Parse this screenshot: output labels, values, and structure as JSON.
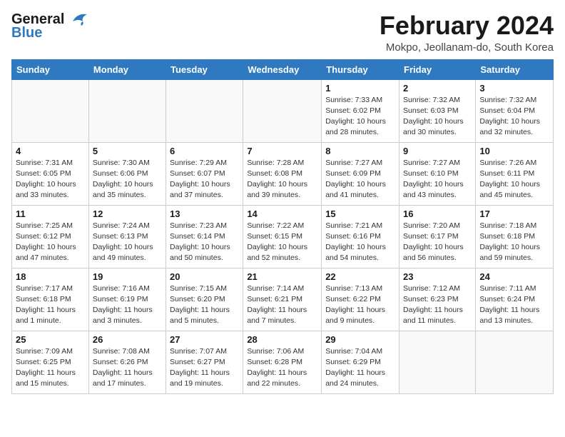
{
  "header": {
    "logo_line1": "General",
    "logo_line2": "Blue",
    "title": "February 2024",
    "subtitle": "Mokpo, Jeollanam-do, South Korea"
  },
  "days_of_week": [
    "Sunday",
    "Monday",
    "Tuesday",
    "Wednesday",
    "Thursday",
    "Friday",
    "Saturday"
  ],
  "weeks": [
    [
      {
        "day": "",
        "info": ""
      },
      {
        "day": "",
        "info": ""
      },
      {
        "day": "",
        "info": ""
      },
      {
        "day": "",
        "info": ""
      },
      {
        "day": "1",
        "info": "Sunrise: 7:33 AM\nSunset: 6:02 PM\nDaylight: 10 hours and 28 minutes."
      },
      {
        "day": "2",
        "info": "Sunrise: 7:32 AM\nSunset: 6:03 PM\nDaylight: 10 hours and 30 minutes."
      },
      {
        "day": "3",
        "info": "Sunrise: 7:32 AM\nSunset: 6:04 PM\nDaylight: 10 hours and 32 minutes."
      }
    ],
    [
      {
        "day": "4",
        "info": "Sunrise: 7:31 AM\nSunset: 6:05 PM\nDaylight: 10 hours and 33 minutes."
      },
      {
        "day": "5",
        "info": "Sunrise: 7:30 AM\nSunset: 6:06 PM\nDaylight: 10 hours and 35 minutes."
      },
      {
        "day": "6",
        "info": "Sunrise: 7:29 AM\nSunset: 6:07 PM\nDaylight: 10 hours and 37 minutes."
      },
      {
        "day": "7",
        "info": "Sunrise: 7:28 AM\nSunset: 6:08 PM\nDaylight: 10 hours and 39 minutes."
      },
      {
        "day": "8",
        "info": "Sunrise: 7:27 AM\nSunset: 6:09 PM\nDaylight: 10 hours and 41 minutes."
      },
      {
        "day": "9",
        "info": "Sunrise: 7:27 AM\nSunset: 6:10 PM\nDaylight: 10 hours and 43 minutes."
      },
      {
        "day": "10",
        "info": "Sunrise: 7:26 AM\nSunset: 6:11 PM\nDaylight: 10 hours and 45 minutes."
      }
    ],
    [
      {
        "day": "11",
        "info": "Sunrise: 7:25 AM\nSunset: 6:12 PM\nDaylight: 10 hours and 47 minutes."
      },
      {
        "day": "12",
        "info": "Sunrise: 7:24 AM\nSunset: 6:13 PM\nDaylight: 10 hours and 49 minutes."
      },
      {
        "day": "13",
        "info": "Sunrise: 7:23 AM\nSunset: 6:14 PM\nDaylight: 10 hours and 50 minutes."
      },
      {
        "day": "14",
        "info": "Sunrise: 7:22 AM\nSunset: 6:15 PM\nDaylight: 10 hours and 52 minutes."
      },
      {
        "day": "15",
        "info": "Sunrise: 7:21 AM\nSunset: 6:16 PM\nDaylight: 10 hours and 54 minutes."
      },
      {
        "day": "16",
        "info": "Sunrise: 7:20 AM\nSunset: 6:17 PM\nDaylight: 10 hours and 56 minutes."
      },
      {
        "day": "17",
        "info": "Sunrise: 7:18 AM\nSunset: 6:18 PM\nDaylight: 10 hours and 59 minutes."
      }
    ],
    [
      {
        "day": "18",
        "info": "Sunrise: 7:17 AM\nSunset: 6:18 PM\nDaylight: 11 hours and 1 minute."
      },
      {
        "day": "19",
        "info": "Sunrise: 7:16 AM\nSunset: 6:19 PM\nDaylight: 11 hours and 3 minutes."
      },
      {
        "day": "20",
        "info": "Sunrise: 7:15 AM\nSunset: 6:20 PM\nDaylight: 11 hours and 5 minutes."
      },
      {
        "day": "21",
        "info": "Sunrise: 7:14 AM\nSunset: 6:21 PM\nDaylight: 11 hours and 7 minutes."
      },
      {
        "day": "22",
        "info": "Sunrise: 7:13 AM\nSunset: 6:22 PM\nDaylight: 11 hours and 9 minutes."
      },
      {
        "day": "23",
        "info": "Sunrise: 7:12 AM\nSunset: 6:23 PM\nDaylight: 11 hours and 11 minutes."
      },
      {
        "day": "24",
        "info": "Sunrise: 7:11 AM\nSunset: 6:24 PM\nDaylight: 11 hours and 13 minutes."
      }
    ],
    [
      {
        "day": "25",
        "info": "Sunrise: 7:09 AM\nSunset: 6:25 PM\nDaylight: 11 hours and 15 minutes."
      },
      {
        "day": "26",
        "info": "Sunrise: 7:08 AM\nSunset: 6:26 PM\nDaylight: 11 hours and 17 minutes."
      },
      {
        "day": "27",
        "info": "Sunrise: 7:07 AM\nSunset: 6:27 PM\nDaylight: 11 hours and 19 minutes."
      },
      {
        "day": "28",
        "info": "Sunrise: 7:06 AM\nSunset: 6:28 PM\nDaylight: 11 hours and 22 minutes."
      },
      {
        "day": "29",
        "info": "Sunrise: 7:04 AM\nSunset: 6:29 PM\nDaylight: 11 hours and 24 minutes."
      },
      {
        "day": "",
        "info": ""
      },
      {
        "day": "",
        "info": ""
      }
    ]
  ]
}
